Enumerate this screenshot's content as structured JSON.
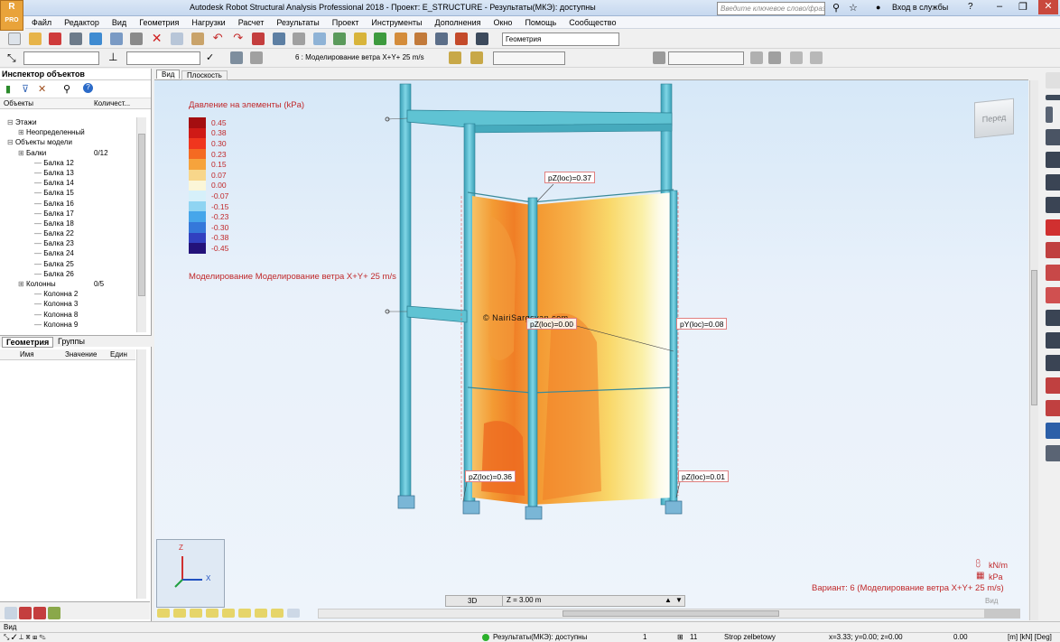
{
  "window": {
    "title": "Autodesk Robot Structural Analysis Professional 2018 - Проект: E_STRUCTURE - Результаты(МКЭ): доступны",
    "search_placeholder": "Введите ключевое слово/фразу",
    "login": "Вход в службы"
  },
  "logo": {
    "line1": "R",
    "line2": "PRO"
  },
  "menu": [
    "Файл",
    "Редактор",
    "Вид",
    "Геометрия",
    "Нагрузки",
    "Расчет",
    "Результаты",
    "Проект",
    "Инструменты",
    "Дополнения",
    "Окно",
    "Помощь",
    "Сообщество"
  ],
  "toolbar": {
    "layout_select": "Геометрия",
    "case_select": "6 : Моделирование ветра X+Y+ 25 m/s"
  },
  "inspector": {
    "title": "Инспектор объектов",
    "col_objects": "Объекты",
    "col_count": "Количест...",
    "tree": [
      {
        "t": "Этажи",
        "d": 1,
        "c": ""
      },
      {
        "t": "Неопределенный",
        "d": 2,
        "c": ""
      },
      {
        "t": "Объекты модели",
        "d": 1,
        "c": ""
      },
      {
        "t": "Балки",
        "d": 2,
        "c": "0/12"
      },
      {
        "t": "Балка 12",
        "d": 3,
        "c": ""
      },
      {
        "t": "Балка 13",
        "d": 3,
        "c": ""
      },
      {
        "t": "Балка 14",
        "d": 3,
        "c": ""
      },
      {
        "t": "Балка 15",
        "d": 3,
        "c": ""
      },
      {
        "t": "Балка 16",
        "d": 3,
        "c": ""
      },
      {
        "t": "Балка 17",
        "d": 3,
        "c": ""
      },
      {
        "t": "Балка 18",
        "d": 3,
        "c": ""
      },
      {
        "t": "Балка 22",
        "d": 3,
        "c": ""
      },
      {
        "t": "Балка 23",
        "d": 3,
        "c": ""
      },
      {
        "t": "Балка 24",
        "d": 3,
        "c": ""
      },
      {
        "t": "Балка 25",
        "d": 3,
        "c": ""
      },
      {
        "t": "Балка 26",
        "d": 3,
        "c": ""
      },
      {
        "t": "Колонны",
        "d": 2,
        "c": "0/5"
      },
      {
        "t": "Колонна 2",
        "d": 3,
        "c": ""
      },
      {
        "t": "Колонна 3",
        "d": 3,
        "c": ""
      },
      {
        "t": "Колонна 8",
        "d": 3,
        "c": ""
      },
      {
        "t": "Колонна 9",
        "d": 3,
        "c": ""
      }
    ],
    "tabs": [
      "Геометрия",
      "Группы"
    ],
    "prop_cols": [
      "Имя",
      "Значение",
      "Един"
    ]
  },
  "view_tabs": [
    "Вид",
    "Плоскость"
  ],
  "legend": {
    "title": "Давление на элементы (kPa)",
    "items": [
      {
        "v": "0.45",
        "c": "#a40e10"
      },
      {
        "v": "0.38",
        "c": "#cf1a16"
      },
      {
        "v": "0.30",
        "c": "#f0361e"
      },
      {
        "v": "0.23",
        "c": "#f46a22"
      },
      {
        "v": "0.15",
        "c": "#f6a33c"
      },
      {
        "v": "0.07",
        "c": "#f8d68a"
      },
      {
        "v": "0.00",
        "c": "#fbf6d8"
      },
      {
        "v": "-0.07",
        "c": "#d6f0fa"
      },
      {
        "v": "-0.15",
        "c": "#8fd4f2"
      },
      {
        "v": "-0.23",
        "c": "#46a6ea"
      },
      {
        "v": "-0.30",
        "c": "#3578da"
      },
      {
        "v": "-0.38",
        "c": "#3140c0"
      },
      {
        "v": "-0.45",
        "c": "#23127a"
      }
    ],
    "subtitle": "Моделирование Моделирование ветра X+Y+ 25 m/s"
  },
  "labels": {
    "top": "pZ(loc)=0.37",
    "mid": "pZ(loc)=0.00",
    "right": "pY(loc)=0.08",
    "bl": "pZ(loc)=0.36",
    "br": "pZ(loc)=0.01"
  },
  "watermark": "© NairiSargsyan.com",
  "viewcube": "Перед",
  "axes": {
    "z": "Z",
    "x": "X"
  },
  "units": {
    "line": "kN/m",
    "area": "kPa"
  },
  "variant": "Вариант: 6 (Моделирование ветра X+Y+ 25 m/s)",
  "viewbar": {
    "mode": "3D",
    "z": "Z = 3.00 m",
    "view": "Вид"
  },
  "bottom_tab": "Вид",
  "status": {
    "results": "Результаты(МКЭ): доступны",
    "n1": "1",
    "n2": "11",
    "section": "Strop zelbetowy",
    "coords": "x=3.33; y=0.00; z=0.00",
    "value": "0.00",
    "units": "[m] [kN] [Deg]"
  },
  "colors": {
    "column": "#56b9cc",
    "beam": "#5fc3d3",
    "foundation": "#7ab6d6",
    "accent": "#c0282a"
  }
}
